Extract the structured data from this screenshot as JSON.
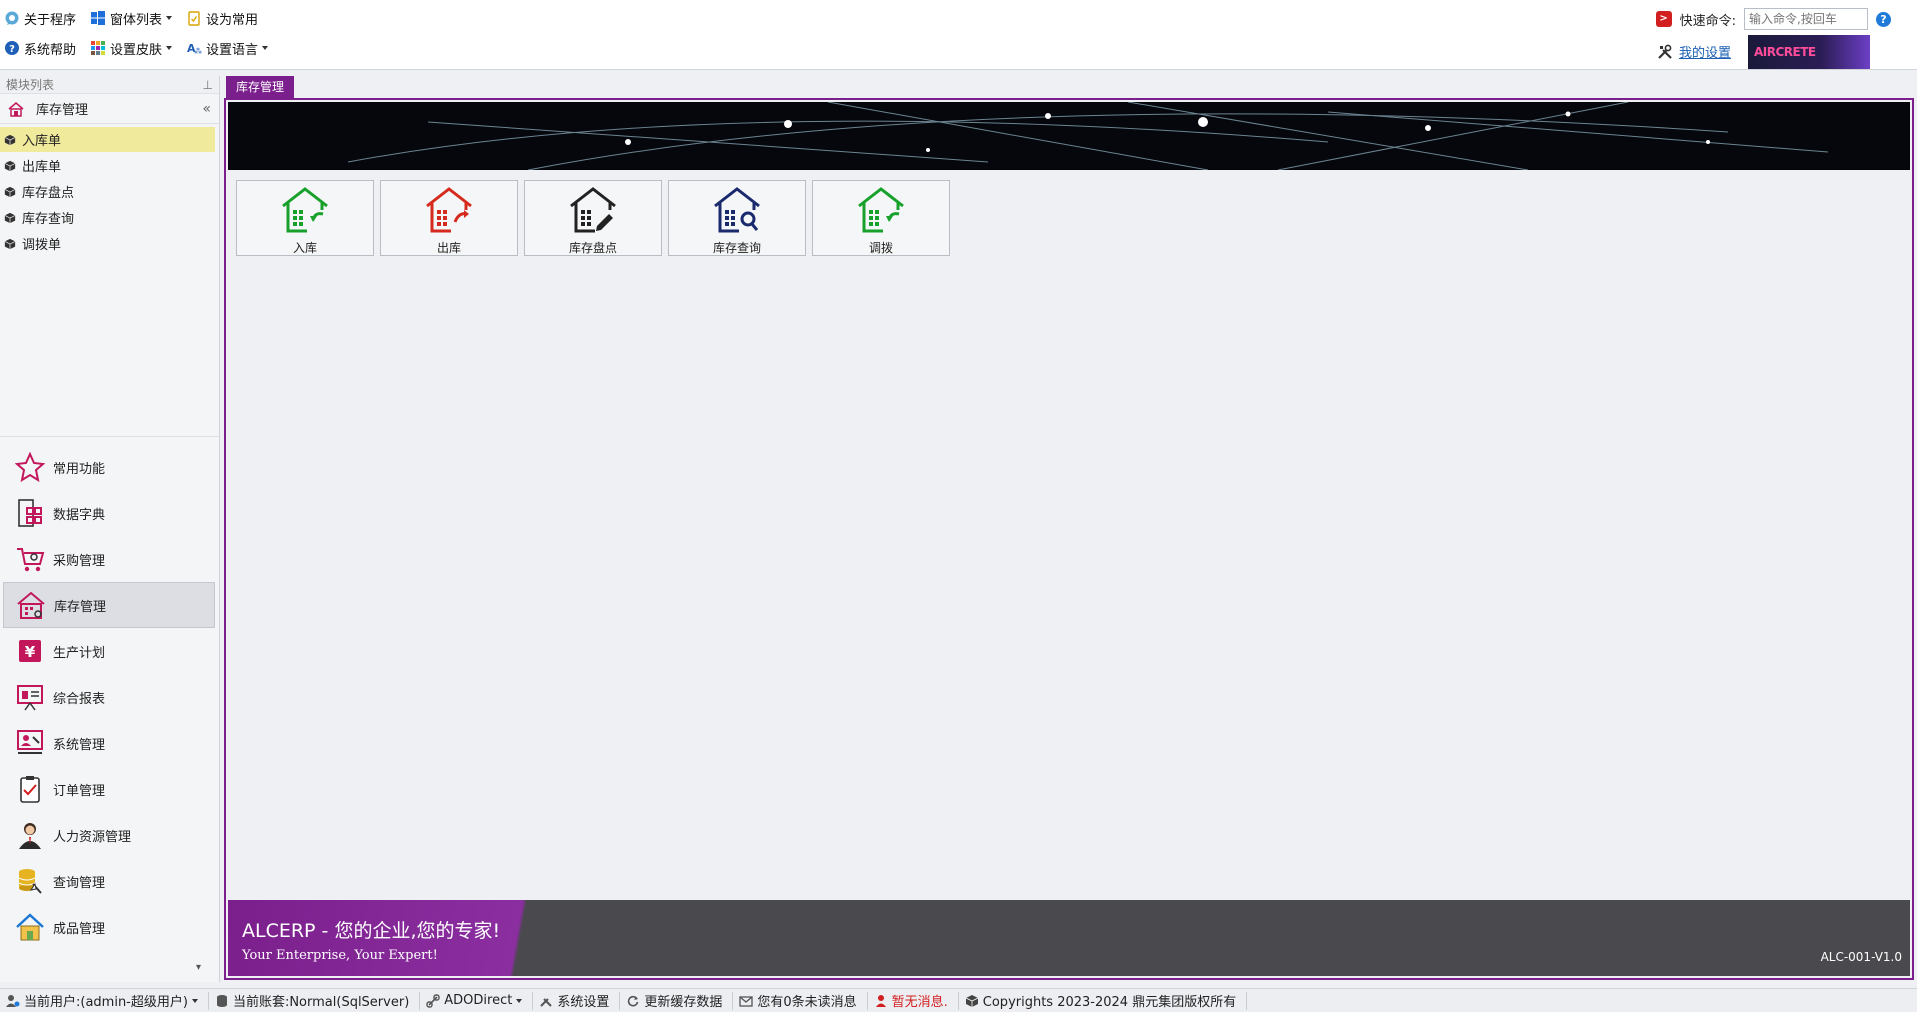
{
  "toolbar": {
    "about": "关于程序",
    "window_list": "窗体列表",
    "set_favorite": "设为常用",
    "help": "系统帮助",
    "skin": "设置皮肤",
    "language": "设置语言",
    "quick_cmd_label": "快速命令:",
    "quick_cmd_placeholder": "输入命令,按回车",
    "my_settings": "我的设置",
    "logo_text": "AIRCRETE"
  },
  "left_panel": {
    "header": "模块列表",
    "pin": "⊥",
    "current_module": "库存管理",
    "collapse": "«",
    "tree_items": [
      {
        "label": "入库单",
        "active": true
      },
      {
        "label": "出库单",
        "active": false
      },
      {
        "label": "库存盘点",
        "active": false
      },
      {
        "label": "库存查询",
        "active": false
      },
      {
        "label": "调拨单",
        "active": false
      }
    ],
    "nav_items": [
      {
        "label": "常用功能",
        "icon": "star-icon"
      },
      {
        "label": "数据字典",
        "icon": "grid-doc-icon"
      },
      {
        "label": "采购管理",
        "icon": "cart-icon"
      },
      {
        "label": "库存管理",
        "icon": "warehouse-icon",
        "active": true
      },
      {
        "label": "生产计划",
        "icon": "yen-icon"
      },
      {
        "label": "综合报表",
        "icon": "report-board-icon"
      },
      {
        "label": "系统管理",
        "icon": "system-admin-icon"
      },
      {
        "label": "订单管理",
        "icon": "clipboard-icon"
      },
      {
        "label": "人力资源管理",
        "icon": "person-icon"
      },
      {
        "label": "查询管理",
        "icon": "database-search-icon"
      },
      {
        "label": "成品管理",
        "icon": "home-icon"
      }
    ],
    "more_arrow": "▾"
  },
  "main": {
    "tab_label": "库存管理",
    "buttons": [
      {
        "label": "入库",
        "icon": "warehouse-in-icon",
        "color": "#17a12b"
      },
      {
        "label": "出库",
        "icon": "warehouse-out-icon",
        "color": "#d52b1e"
      },
      {
        "label": "库存盘点",
        "icon": "warehouse-count-icon",
        "color": "#222222"
      },
      {
        "label": "库存查询",
        "icon": "warehouse-search-icon",
        "color": "#1a2a6c"
      },
      {
        "label": "调拨",
        "icon": "warehouse-transfer-icon",
        "color": "#17a12b"
      }
    ],
    "footer_title": "ALCERP - 您的企业,您的专家!",
    "footer_sub": "Your Enterprise, Your Expert!",
    "version": "ALC-001-V1.0"
  },
  "statusbar": {
    "user": "当前用户:(admin-超级用户)",
    "account": "当前账套:Normal(SqlServer)",
    "conn": "ADODirect",
    "sys_settings": "系统设置",
    "refresh_cache": "更新缓存数据",
    "unread": "您有0条未读消息",
    "no_msg": "暂无消息.",
    "copyright": "Copyrights 2023-2024 鼎元集团版权所有"
  },
  "colors": {
    "accent": "#7b1f8c",
    "active_tree": "#f0eb9c"
  }
}
